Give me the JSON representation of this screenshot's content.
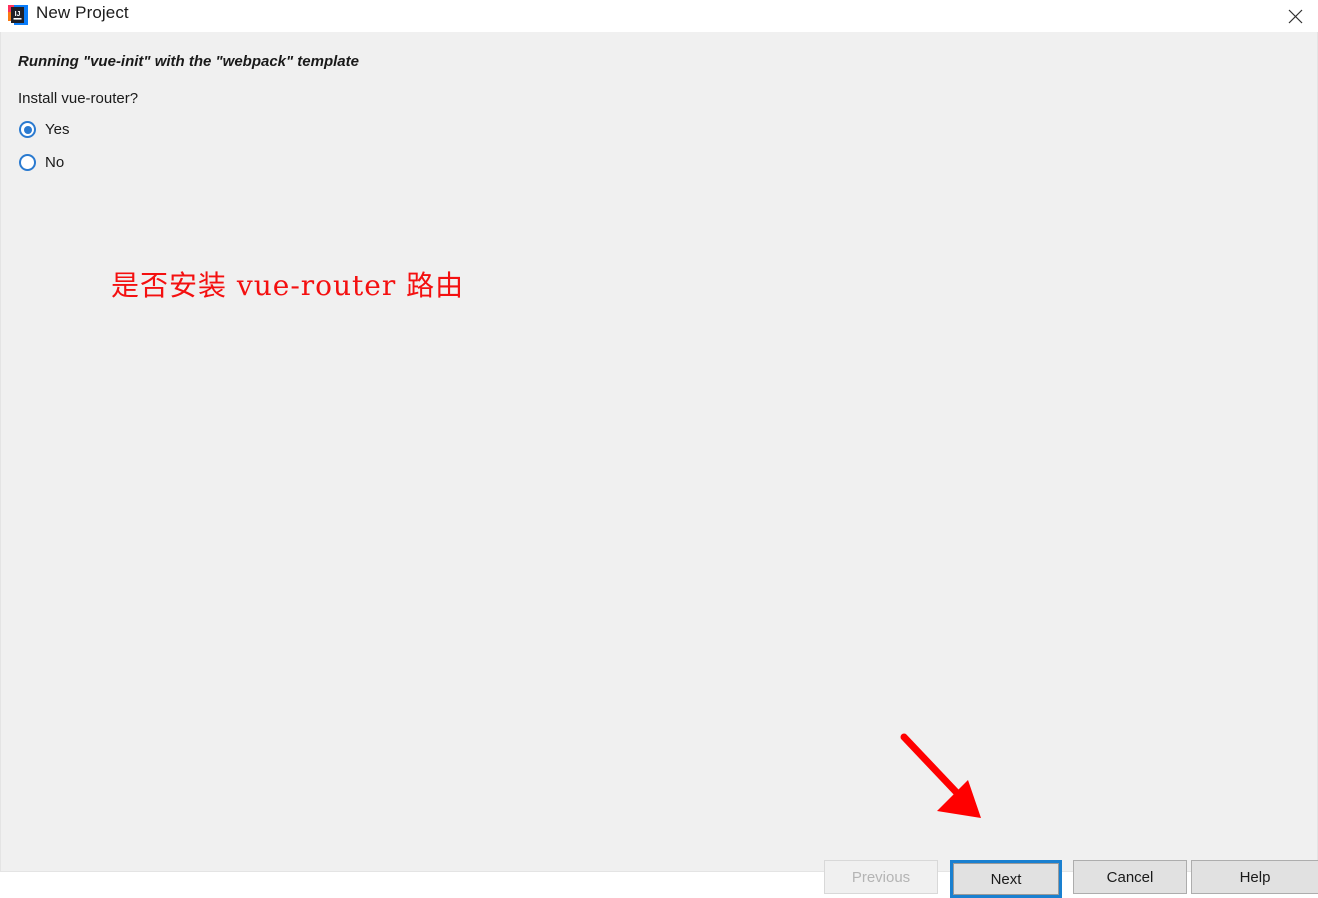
{
  "window": {
    "title": "New Project",
    "app_icon": "intellij-idea-icon",
    "close_icon": "close-icon",
    "bg_color": "#f0f0f0",
    "titlebar_color": "#ffffff"
  },
  "wizard": {
    "running_line": "Running \"vue-init\" with the \"webpack\" template",
    "question_label": "Install vue-router?",
    "options": [
      {
        "label": "Yes",
        "checked": true
      },
      {
        "label": "No",
        "checked": false
      }
    ],
    "accent_color": "#2a7ad0"
  },
  "annotation": {
    "text": "是否安装 vue-router 路由",
    "color": "#f41010",
    "arrow_color": "#ff0000",
    "arrow_name": "red-pointer-arrow"
  },
  "buttons": {
    "previous": "Previous",
    "next": "Next",
    "cancel": "Cancel",
    "help": "Help",
    "focus_color": "#1a80d0"
  }
}
